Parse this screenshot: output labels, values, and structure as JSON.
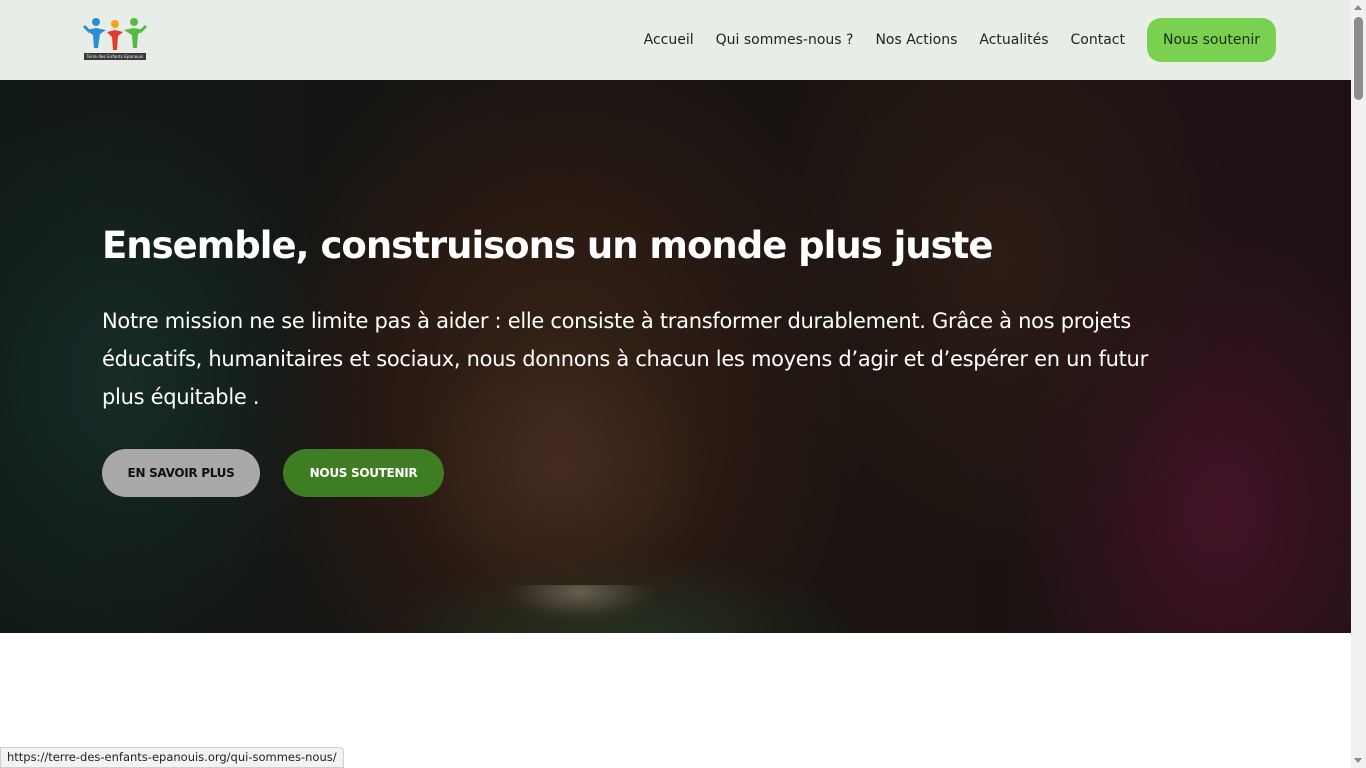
{
  "header": {
    "logo_caption": "Terre des Enfants Epanouis",
    "nav": [
      {
        "label": "Accueil"
      },
      {
        "label": "Qui sommes-nous ?"
      },
      {
        "label": "Nos Actions"
      },
      {
        "label": "Actualités"
      },
      {
        "label": "Contact"
      }
    ],
    "cta_label": "Nous soutenir"
  },
  "hero": {
    "title": "Ensemble, construisons un monde plus juste",
    "text": "Notre mission ne se limite pas à aider : elle consiste à transformer durablement. Grâce à nos projets éducatifs, humanitaires et sociaux, nous donnons à chacun les moyens d’agir et d’espérer en un futur plus équitable .",
    "btn_more": "EN SAVOIR PLUS",
    "btn_support": "NOUS SOUTENIR"
  },
  "status_url": "https://terre-des-enfants-epanouis.org/qui-sommes-nous/",
  "colors": {
    "header_bg": "#e9ede7",
    "cta_green": "#7ad14f",
    "support_green": "#3f7d22",
    "more_grey": "#a9a9a9"
  }
}
